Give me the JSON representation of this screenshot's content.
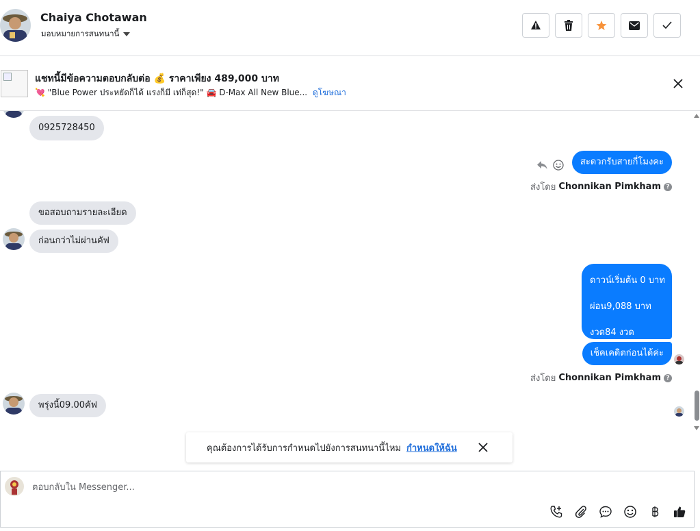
{
  "header": {
    "contact_name": "Chaiya Chotawan",
    "assign_label": "มอบหมายการสนทนานี้",
    "actions": [
      {
        "name": "spam-button",
        "icon": "warning-icon"
      },
      {
        "name": "delete-button",
        "icon": "trash-icon"
      },
      {
        "name": "star-button",
        "icon": "star-icon"
      },
      {
        "name": "mark-unread-button",
        "icon": "envelope-icon"
      },
      {
        "name": "mark-done-button",
        "icon": "checkmark-icon"
      }
    ]
  },
  "ad_banner": {
    "title": "แชทนี้มีข้อความตอบกลับต่อ 💰 ราคาเพียง 489,000 บาท",
    "subtitle": "💘 \"Blue Power ประหยัดก็ได้ แรงก็มี เท่ก็สุด!\" 🚘 D-Max All New Blue...",
    "link_label": "ดูโฆษณา"
  },
  "messages": [
    {
      "dir": "in",
      "text": "0925728450"
    },
    {
      "dir": "out",
      "text": "สะดวกรับสายกี่โมงคะ"
    },
    {
      "sent_by_prefix": "ส่งโดย",
      "sender": "Chonnikan Pimkham"
    },
    {
      "dir": "in",
      "text": "ขอสอบถามรายละเอียด"
    },
    {
      "dir": "in",
      "text": "ก่อนกว่าไม่ผ่านคัฟ"
    },
    {
      "dir": "out",
      "lines": [
        "ดาวน์เริ่มต้น 0 บาท",
        "ผ่อน9,088 บาท",
        "งวด84 งวด"
      ]
    },
    {
      "dir": "out",
      "text": "เช็คเคดิตก่อนได้ค่ะ"
    },
    {
      "sent_by_prefix": "ส่งโดย",
      "sender": "Chonnikan Pimkham"
    },
    {
      "dir": "in",
      "text": "พรุ่งนี้09.00คัฟ"
    }
  ],
  "reminder": {
    "text": "คุณต้องการได้รับการกำหนดไปยังการสนทนานี้ไหม",
    "link_label": "กำหนดให้ฉัน"
  },
  "composer": {
    "placeholder": "ตอบกลับใน Messenger...",
    "tools": [
      "phone-add-icon",
      "paperclip-icon",
      "chat-bubble-icon",
      "emoji-icon",
      "baht-icon",
      "thumbs-up-icon"
    ]
  },
  "colors": {
    "accent": "#0a7cff",
    "incoming_bubble": "#e4e6eb",
    "link": "#216fdb",
    "star": "#f7923a"
  }
}
